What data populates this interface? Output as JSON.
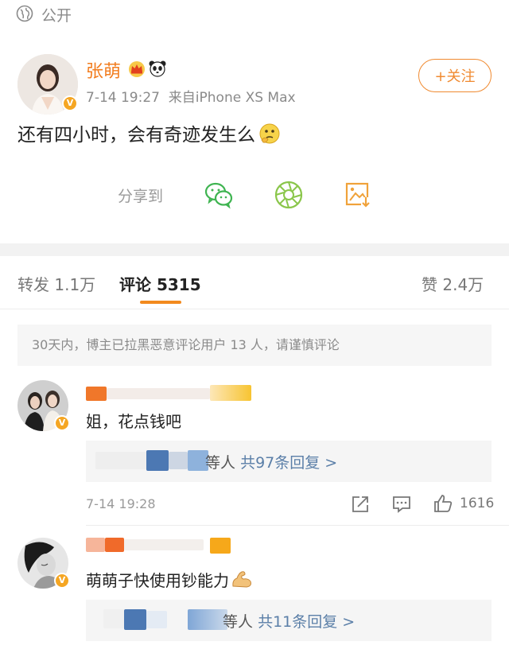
{
  "header": {
    "visibility_label": "公开",
    "visibility_icon": "globe-icon"
  },
  "post": {
    "author": "张萌",
    "author_badges": [
      "crown-icon",
      "panda-icon"
    ],
    "time": "7-14 19:27",
    "source": "来自iPhone XS Max",
    "follow_label": "+关注",
    "text": "还有四小时，会有奇迹发生么",
    "text_emoji": "thinking-emoji",
    "share_label": "分享到",
    "share_targets": [
      "wechat-icon",
      "moments-icon",
      "save-image-icon"
    ]
  },
  "tabs": {
    "repost": "转发 1.1万",
    "comments": "评论 5315",
    "likes": "赞 2.4万"
  },
  "notice": "30天内，博主已拉黑恶意评论用户 13 人，请谨慎评论",
  "comments": [
    {
      "text": "姐，花点钱吧",
      "reply_who": "等人",
      "reply_link": "共97条回复 >",
      "time": "7-14 19:28",
      "like_count": "1616"
    },
    {
      "text": "萌萌子快使用钞能力",
      "text_emoji": "muscle-emoji",
      "reply_who": "等人",
      "reply_link": "共11条回复 >"
    }
  ],
  "colors": {
    "brand_orange": "#f27d1f",
    "link_blue": "#5b7fa8",
    "verified_badge": "#f5a623",
    "tab_underline": "#f28a1e"
  }
}
